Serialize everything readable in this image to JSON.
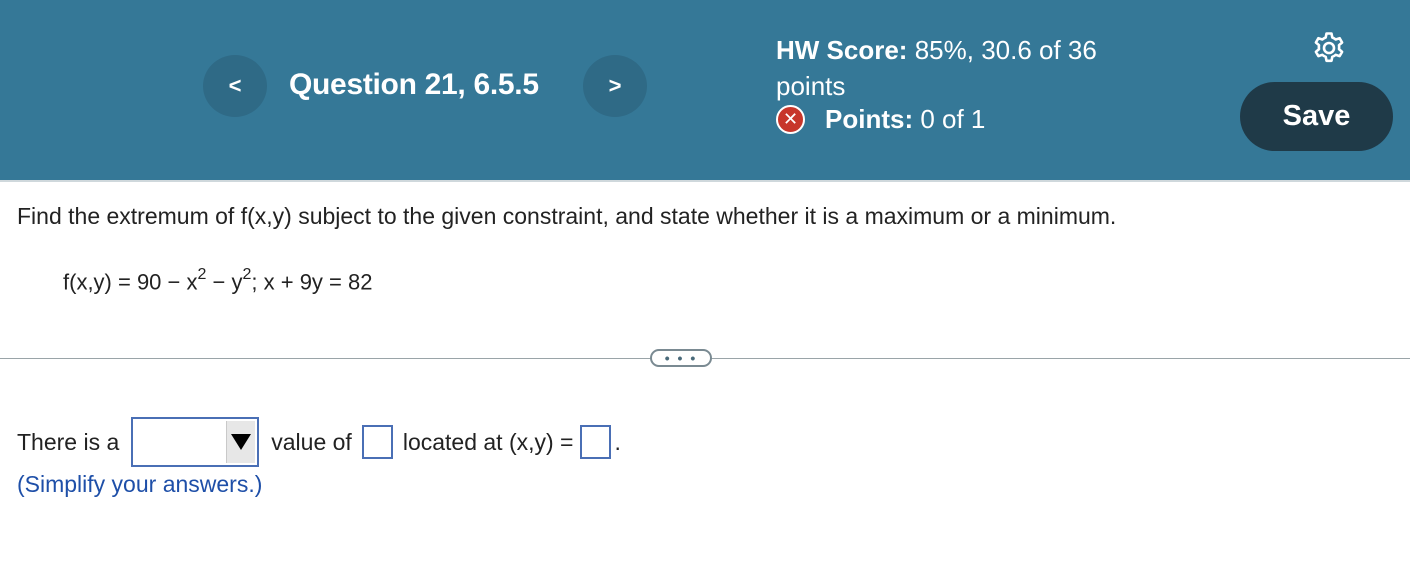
{
  "header": {
    "question_title": "Question 21, 6.5.5",
    "prev_label": "<",
    "next_label": ">",
    "hw_score_label": "HW Score:",
    "hw_score_value": "85%, 30.6 of 36",
    "hw_score_value_line2": "points",
    "points_label": "Points:",
    "points_value": "0 of 1",
    "status_icon": "x-circle-icon",
    "save_label": "Save",
    "settings_icon": "gear-icon"
  },
  "colors": {
    "header_bg": "#357897",
    "nav_button_bg": "#2f6a86",
    "save_button_bg": "#1f3a48",
    "error_badge": "#c7362b",
    "hint_text": "#1e4fa8",
    "input_border": "#4a6fb5"
  },
  "question": {
    "prompt": "Find the extremum of f(x,y) subject to the given constraint, and state whether it is a maximum or a minimum.",
    "formula_part1": "f(x,y) = 90 − x",
    "formula_exp1": "2",
    "formula_part2": " − y",
    "formula_exp2": "2",
    "formula_part3": "; x + 9y = 82",
    "more_label": "• • •"
  },
  "answer": {
    "text1": "There is a",
    "select_value": "",
    "text2": "value of",
    "value_input": "",
    "text3": "located at (x,y) =",
    "point_input": "",
    "text4": ".",
    "hint": "(Simplify your answers.)"
  }
}
